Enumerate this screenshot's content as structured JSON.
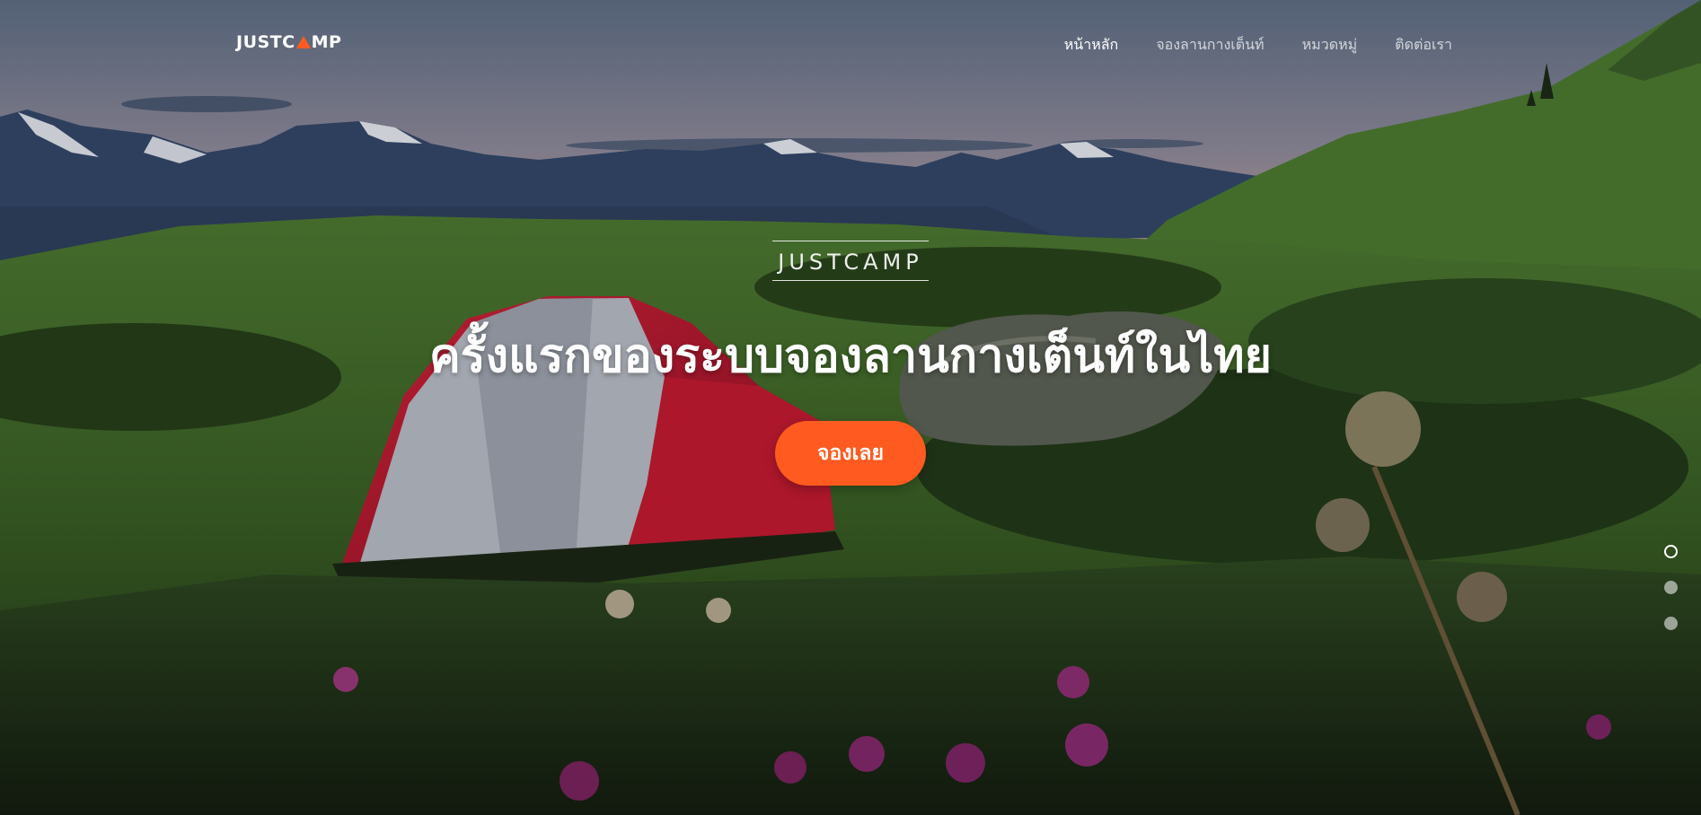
{
  "header": {
    "logo_text_left": "JUSTC",
    "logo_text_right": "MP",
    "nav": [
      {
        "label": "หน้าหลัก",
        "active": true
      },
      {
        "label": "จองลานกางเต็นท์",
        "active": false
      },
      {
        "label": "หมวดหมู่",
        "active": false
      },
      {
        "label": "ติดต่อเรา",
        "active": false
      }
    ]
  },
  "hero": {
    "brand": "JUSTCAMP",
    "headline": "ครั้งแรกของระบบจองลานกางเต็นท์ในไทย",
    "cta_label": "จองเลย",
    "slides_total": 3,
    "active_slide": 1
  },
  "colors": {
    "accent": "#ff5a1f",
    "text": "#ffffff"
  }
}
